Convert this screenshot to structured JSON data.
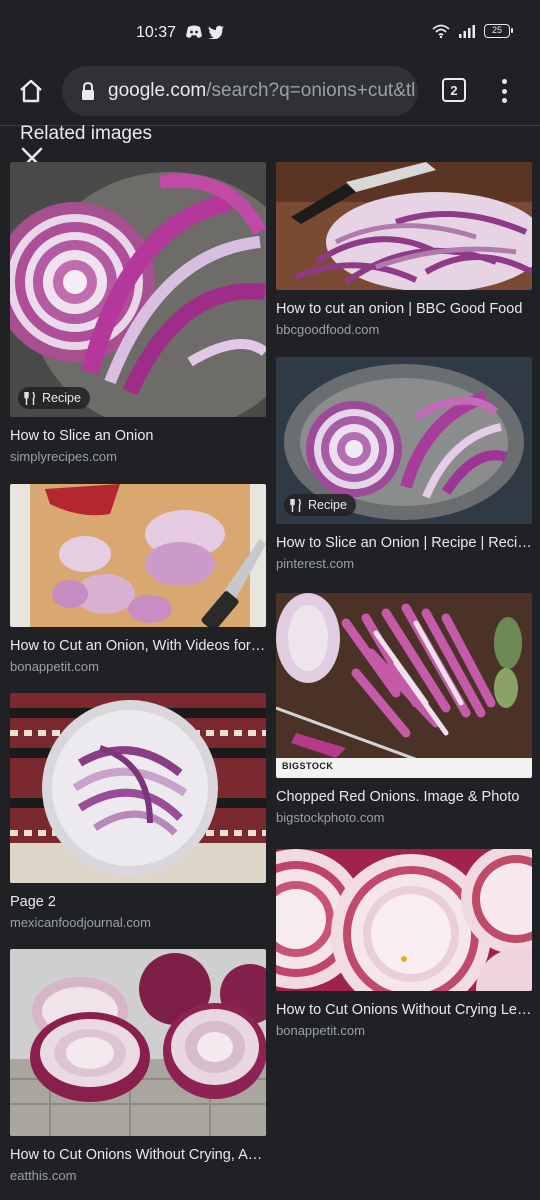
{
  "status": {
    "time": "10:37",
    "battery": "25",
    "app_icons": [
      "discord-icon",
      "twitter-icon"
    ]
  },
  "toolbar": {
    "url_host": "google.com",
    "url_path": "/search?q=onions+cut&tl",
    "tab_count": "2"
  },
  "related": {
    "title": "Related images"
  },
  "results": [
    {
      "title": "How to Slice an Onion",
      "source": "simplyrecipes.com",
      "badge": "Recipe"
    },
    {
      "title": "How to cut an onion | BBC Good Food",
      "source": "bbcgoodfood.com"
    },
    {
      "title": "How to Slice an Onion | Recipe | Recipe",
      "source": "pinterest.com",
      "badge": "Recipe"
    },
    {
      "title": "How to Cut an Onion, With Videos for Beginners",
      "source": "bonappetit.com"
    },
    {
      "title": "Chopped Red Onions. Image & Photo",
      "source": "bigstockphoto.com",
      "watermark": "BIGSTOCK"
    },
    {
      "title": "Page 2",
      "source": "mexicanfoodjournal.com"
    },
    {
      "title": "How to Cut Onions Without Crying Learn",
      "source": "bonappetit.com"
    },
    {
      "title": "How to Cut Onions Without Crying, According",
      "source": "eatthis.com"
    }
  ],
  "colors": {
    "background": "#202124",
    "omnibox": "#303134",
    "text_primary": "#e8eaed",
    "text_secondary": "#9aa0a6"
  }
}
